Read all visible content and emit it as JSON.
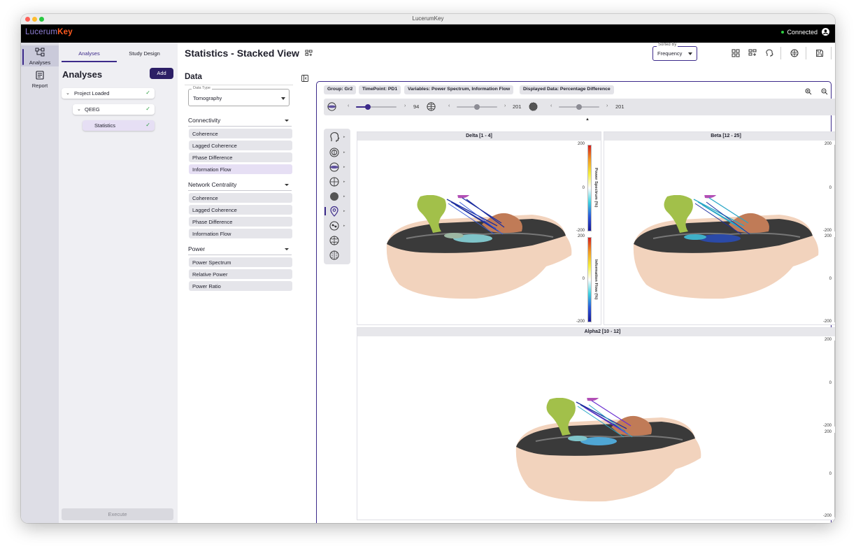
{
  "window": {
    "title": "LucerumKey"
  },
  "app": {
    "logo_a": "Lucerum",
    "logo_b": "Key",
    "status": "Connected"
  },
  "nav_rail": {
    "items": [
      {
        "label": "Analyses",
        "icon": "workflow-icon"
      },
      {
        "label": "Report",
        "icon": "report-icon"
      }
    ]
  },
  "sidebar": {
    "tabs": [
      "Analyses",
      "Study Design"
    ],
    "title": "Analyses",
    "add_label": "Add",
    "tree": [
      {
        "label": "Project Loaded"
      },
      {
        "label": "QEEG"
      },
      {
        "label": "Statistics"
      }
    ],
    "execute_label": "Execute"
  },
  "header": {
    "title": "Statistics - Stacked View",
    "sorted_by": {
      "label": "Sorted By",
      "value": "Frequency"
    }
  },
  "data_panel": {
    "title": "Data",
    "data_type": {
      "label": "Data Type",
      "value": "Tomography"
    },
    "sections": [
      {
        "title": "Connectivity",
        "items": [
          "Coherence",
          "Lagged Coherence",
          "Phase Difference",
          "Information Flow"
        ]
      },
      {
        "title": "Network Centrality",
        "items": [
          "Coherence",
          "Lagged Coherence",
          "Phase Difference",
          "Information Flow"
        ]
      },
      {
        "title": "Power",
        "items": [
          "Power Spectrum",
          "Relative Power",
          "Power Ratio"
        ]
      }
    ]
  },
  "viewer": {
    "chips": [
      "Group: Gr2",
      "TimePoint: PD1",
      "Variables: Power Spectrum, Information Flow",
      "Displayed Data: Percentage Difference"
    ],
    "sliders": [
      {
        "value": "94",
        "level": 0.3
      },
      {
        "value": "201",
        "level": 0.5
      },
      {
        "value": "201",
        "level": 0.5
      }
    ],
    "panels": [
      {
        "title": "Delta [1 - 4]"
      },
      {
        "title": "Beta [12 - 25]"
      },
      {
        "title": "Alpha2 [10 - 12]"
      }
    ],
    "colorbars": [
      {
        "label": "Power Spectrum (%)",
        "max": "200",
        "mid": "0",
        "min": "-200"
      },
      {
        "label": "Information Flow (%)",
        "max": "200",
        "mid": "0",
        "min": "-200"
      }
    ]
  }
}
